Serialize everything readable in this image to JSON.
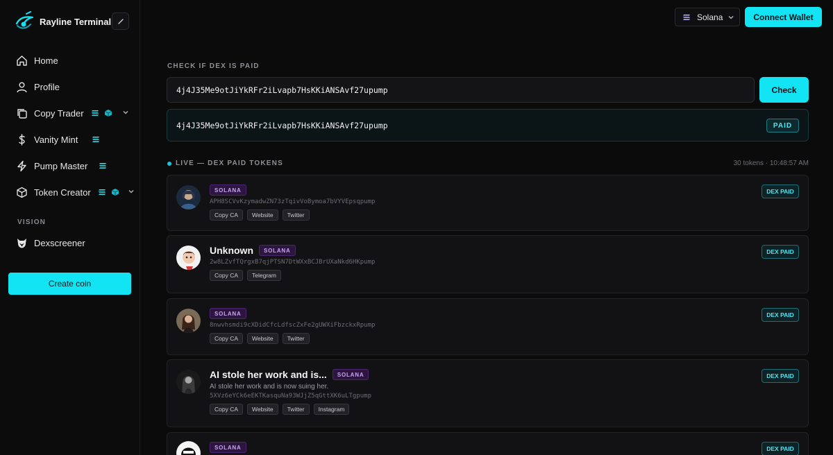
{
  "brand": {
    "name": "Rayline Terminal"
  },
  "sidebar": {
    "items": [
      {
        "label": "Home"
      },
      {
        "label": "Profile"
      },
      {
        "label": "Copy Trader"
      },
      {
        "label": "Vanity Mint"
      },
      {
        "label": "Pump Master"
      },
      {
        "label": "Token Creator"
      }
    ],
    "section_label": "VISION",
    "vision_items": [
      {
        "label": "Dexscreener"
      }
    ],
    "create_label": "Create coin"
  },
  "topbar": {
    "network": "Solana",
    "connect_label": "Connect Wallet"
  },
  "check": {
    "title": "CHECK IF DEX IS PAID",
    "input_value": "4j4J35Me9otJiYkRFr2iLvapb7HsKKiANSAvf27upump",
    "button_label": "Check",
    "result_address": "4j4J35Me9otJiYkRFr2iLvapb7HsKKiANSAvf27upump",
    "result_status": "PAID"
  },
  "live": {
    "title": "LIVE — DEX PAID TOKENS",
    "meta": "30 tokens · 10:48:57 AM"
  },
  "tokens": [
    {
      "name": "",
      "chain": "SOLANA",
      "description": "",
      "ca": "APH8SCVvKzymadwZN73zTqivVoBymoa7bVYVEpsqpump",
      "links": [
        "Copy CA",
        "Website",
        "Twitter"
      ],
      "status": "DEX PAID"
    },
    {
      "name": "Unknown",
      "chain": "SOLANA",
      "description": "",
      "ca": "2w8LZvfTQrgxB7qjPTSN7DtWXxBCJBrUXaNkd6HKpump",
      "links": [
        "Copy CA",
        "Telegram"
      ],
      "status": "DEX PAID"
    },
    {
      "name": "",
      "chain": "SOLANA",
      "description": "",
      "ca": "8nwvhsmdi9cXDidCfcLdfscZxFe2gUWXiFbzckxRpump",
      "links": [
        "Copy CA",
        "Website",
        "Twitter"
      ],
      "status": "DEX PAID"
    },
    {
      "name": "AI stole her work and is...",
      "chain": "SOLANA",
      "description": "AI stole her work and is now suing her.",
      "ca": "5XVz6eYCk6eEKTKasquNa93WJjZ5qGttXK6uLTgpump",
      "links": [
        "Copy CA",
        "Website",
        "Twitter",
        "Instagram"
      ],
      "status": "DEX PAID"
    },
    {
      "name": "",
      "chain": "SOLANA",
      "description": "",
      "ca": "",
      "links": [],
      "status": "DEX PAID"
    }
  ],
  "colors": {
    "accent": "#12e4f4",
    "background": "#0b0b0c",
    "card": "#121214",
    "chain_badge": "#2c1640"
  },
  "icons": [
    "eye-logo-icon",
    "pencil-icon",
    "home-icon",
    "user-icon",
    "copy-icon",
    "dollar-icon",
    "bolt-icon",
    "cube-icon",
    "solana-icon",
    "chevron-down-icon",
    "owl-icon"
  ]
}
